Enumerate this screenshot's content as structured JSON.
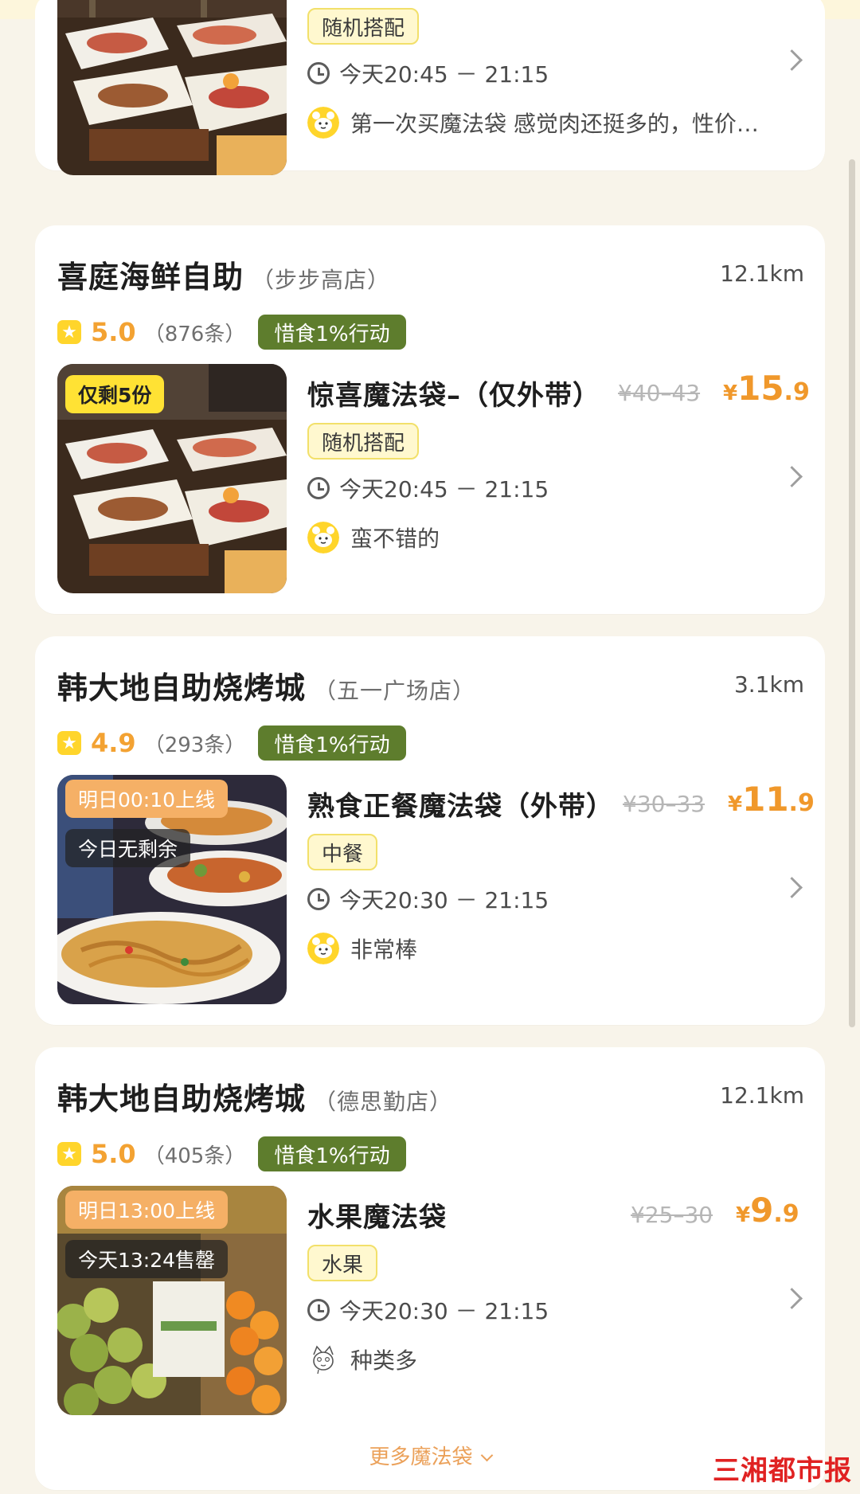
{
  "colors": {
    "accent_orange": "#f0982b",
    "action_green": "#5e7d2d",
    "tag_yellow": "#fff8cf",
    "background": "#f8f4ea",
    "watermark_red": "#e02222"
  },
  "cards": [
    {
      "category": "随机搭配",
      "time": "今天20:45 － 21:15",
      "review": "第一次买魔法袋 感觉肉还挺多的，性价…",
      "review_avatar": "yellow-bear-icon"
    },
    {
      "store_name": "喜庭海鲜自助",
      "branch": "（步步高店）",
      "distance": "12.1km",
      "rating": "5.0",
      "reviews": "（876条）",
      "action_badge": "惜食1%行动",
      "photo_tags": [
        "仅剩5份"
      ],
      "bag_title": "惊喜魔法袋–（仅外带）",
      "old_price": "¥40–43",
      "price": {
        "symbol": "¥",
        "int": "15",
        "dec": ".9"
      },
      "category": "随机搭配",
      "time": "今天20:45 － 21:15",
      "review": "蛮不错的",
      "review_avatar": "yellow-bear-icon"
    },
    {
      "store_name": "韩大地自助烧烤城",
      "branch": "（五一广场店）",
      "distance": "3.1km",
      "rating": "4.9",
      "reviews": "（293条）",
      "action_badge": "惜食1%行动",
      "photo_tags": [
        "明日00:10上线",
        "今日无剩余"
      ],
      "bag_title": "熟食正餐魔法袋（外带）",
      "old_price": "¥30–33",
      "price": {
        "symbol": "¥",
        "int": "11",
        "dec": ".9"
      },
      "category": "中餐",
      "time": "今天20:30 － 21:15",
      "review": "非常棒",
      "review_avatar": "yellow-bear-icon"
    },
    {
      "store_name": "韩大地自助烧烤城",
      "branch": "（德思勤店）",
      "distance": "12.1km",
      "rating": "5.0",
      "reviews": "（405条）",
      "action_badge": "惜食1%行动",
      "photo_tags": [
        "明日13:00上线",
        "今天13:24售罄"
      ],
      "bag_title": "水果魔法袋",
      "old_price": "¥25–30",
      "price": {
        "symbol": "¥",
        "int": "9",
        "dec": ".9"
      },
      "category": "水果",
      "time": "今天20:30 － 21:15",
      "review": "种类多",
      "review_avatar": "sketch-cat-icon",
      "more_link": "更多魔法袋"
    }
  ],
  "watermark": "三湘都市报"
}
